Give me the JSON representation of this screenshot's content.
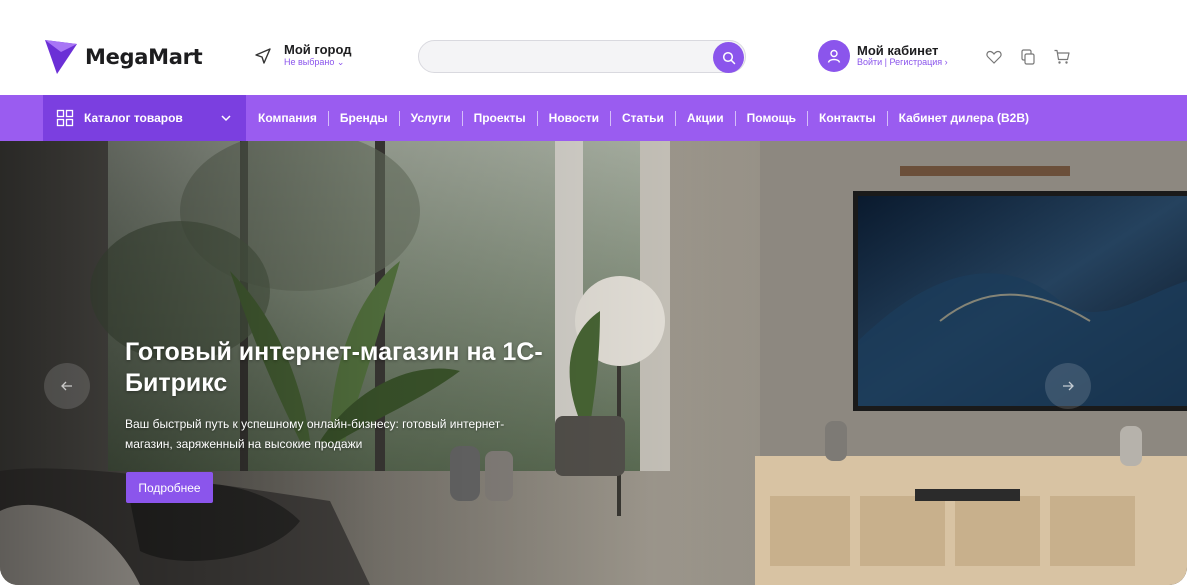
{
  "brand": {
    "name": "MegaMart",
    "accent": "#8b55ec",
    "nav_bg": "#9a5cf0",
    "catalog_bg": "#7b3fe0"
  },
  "city": {
    "title": "Мой город",
    "subtitle": "Не выбрано ⌄",
    "icon": "navigation-arrow-icon"
  },
  "search": {
    "value": "",
    "placeholder": "",
    "icon": "search-icon"
  },
  "account": {
    "title": "Мой кабинет",
    "subtitle": "Войти | Регистрация ›",
    "icon": "user-icon"
  },
  "header_icons": [
    "heart-icon",
    "compare-icon",
    "cart-icon"
  ],
  "nav": {
    "catalog_label": "Каталог товаров",
    "items": [
      {
        "label": "Компания"
      },
      {
        "label": "Бренды"
      },
      {
        "label": "Услуги"
      },
      {
        "label": "Проекты"
      },
      {
        "label": "Новости"
      },
      {
        "label": "Статьи"
      },
      {
        "label": "Акции"
      },
      {
        "label": "Помощь"
      },
      {
        "label": "Контакты"
      },
      {
        "label": "Кабинет дилера (B2B)"
      }
    ]
  },
  "hero": {
    "title": "Готовый интернет-магазин на 1С-Битрикс",
    "description": "Ваш быстрый путь к успешному онлайн-бизнесу: готовый интернет-магазин, заряженный на высокие продажи",
    "button_label": "Подробнее"
  }
}
